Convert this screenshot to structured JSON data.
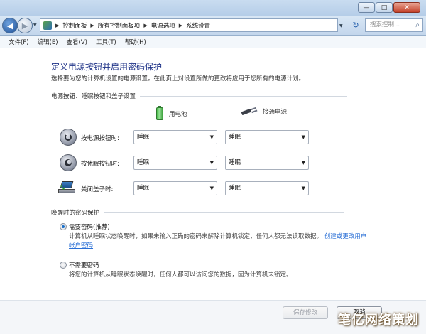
{
  "window": {
    "controls": {
      "minimize": "—",
      "maximize": "□",
      "close": "✕"
    }
  },
  "address": {
    "back_icon": "back-arrow-icon",
    "forward_icon": "forward-arrow-icon",
    "breadcrumbs": [
      "控制面板",
      "所有控制面板项",
      "电源选项",
      "系统设置"
    ],
    "refresh_icon": "refresh-icon",
    "search_placeholder": "搜索控制...",
    "search_icon": "search-icon"
  },
  "menu": [
    "文件(F)",
    "编辑(E)",
    "查看(V)",
    "工具(T)",
    "帮助(H)"
  ],
  "page": {
    "title": "定义电源按钮并启用密码保护",
    "description": "选择要为您的计算机设置的电源设置。在此页上对设置所做的更改将应用于您所有的电源计划。"
  },
  "power_section": {
    "heading": "电源按钮、睡眠按钮和盖子设置",
    "on_battery": "用电池",
    "plugged_in": "接通电源",
    "rows": [
      {
        "label": "按电源按钮时:",
        "battery": "睡眠",
        "ac": "睡眠",
        "icon": "power-button-icon"
      },
      {
        "label": "按休眠按钮时:",
        "battery": "睡眠",
        "ac": "睡眠",
        "icon": "sleep-button-icon"
      },
      {
        "label": "关闭盖子时:",
        "battery": "睡眠",
        "ac": "睡眠",
        "icon": "laptop-lid-icon"
      }
    ]
  },
  "password_section": {
    "heading": "唤醒时的密码保护",
    "require": {
      "label": "需要密码(推荐)",
      "desc": "计算机从睡眠状态唤醒时，如果未输入正确的密码来解除计算机锁定，任何人都无法读取数据。",
      "link": "创建或更改用户帐户密码",
      "checked": true
    },
    "no_require": {
      "label": "不需要密码",
      "desc": "将您的计算机从睡眠状态唤醒时，任何人都可以访问您的数据，因为计算机未锁定。",
      "checked": false
    }
  },
  "footer": {
    "save": "保存修改",
    "cancel": "取消"
  },
  "watermark": "笔亿网络策划",
  "colors": {
    "title_blue": "#1e3287",
    "link_blue": "#2a6fd6"
  }
}
